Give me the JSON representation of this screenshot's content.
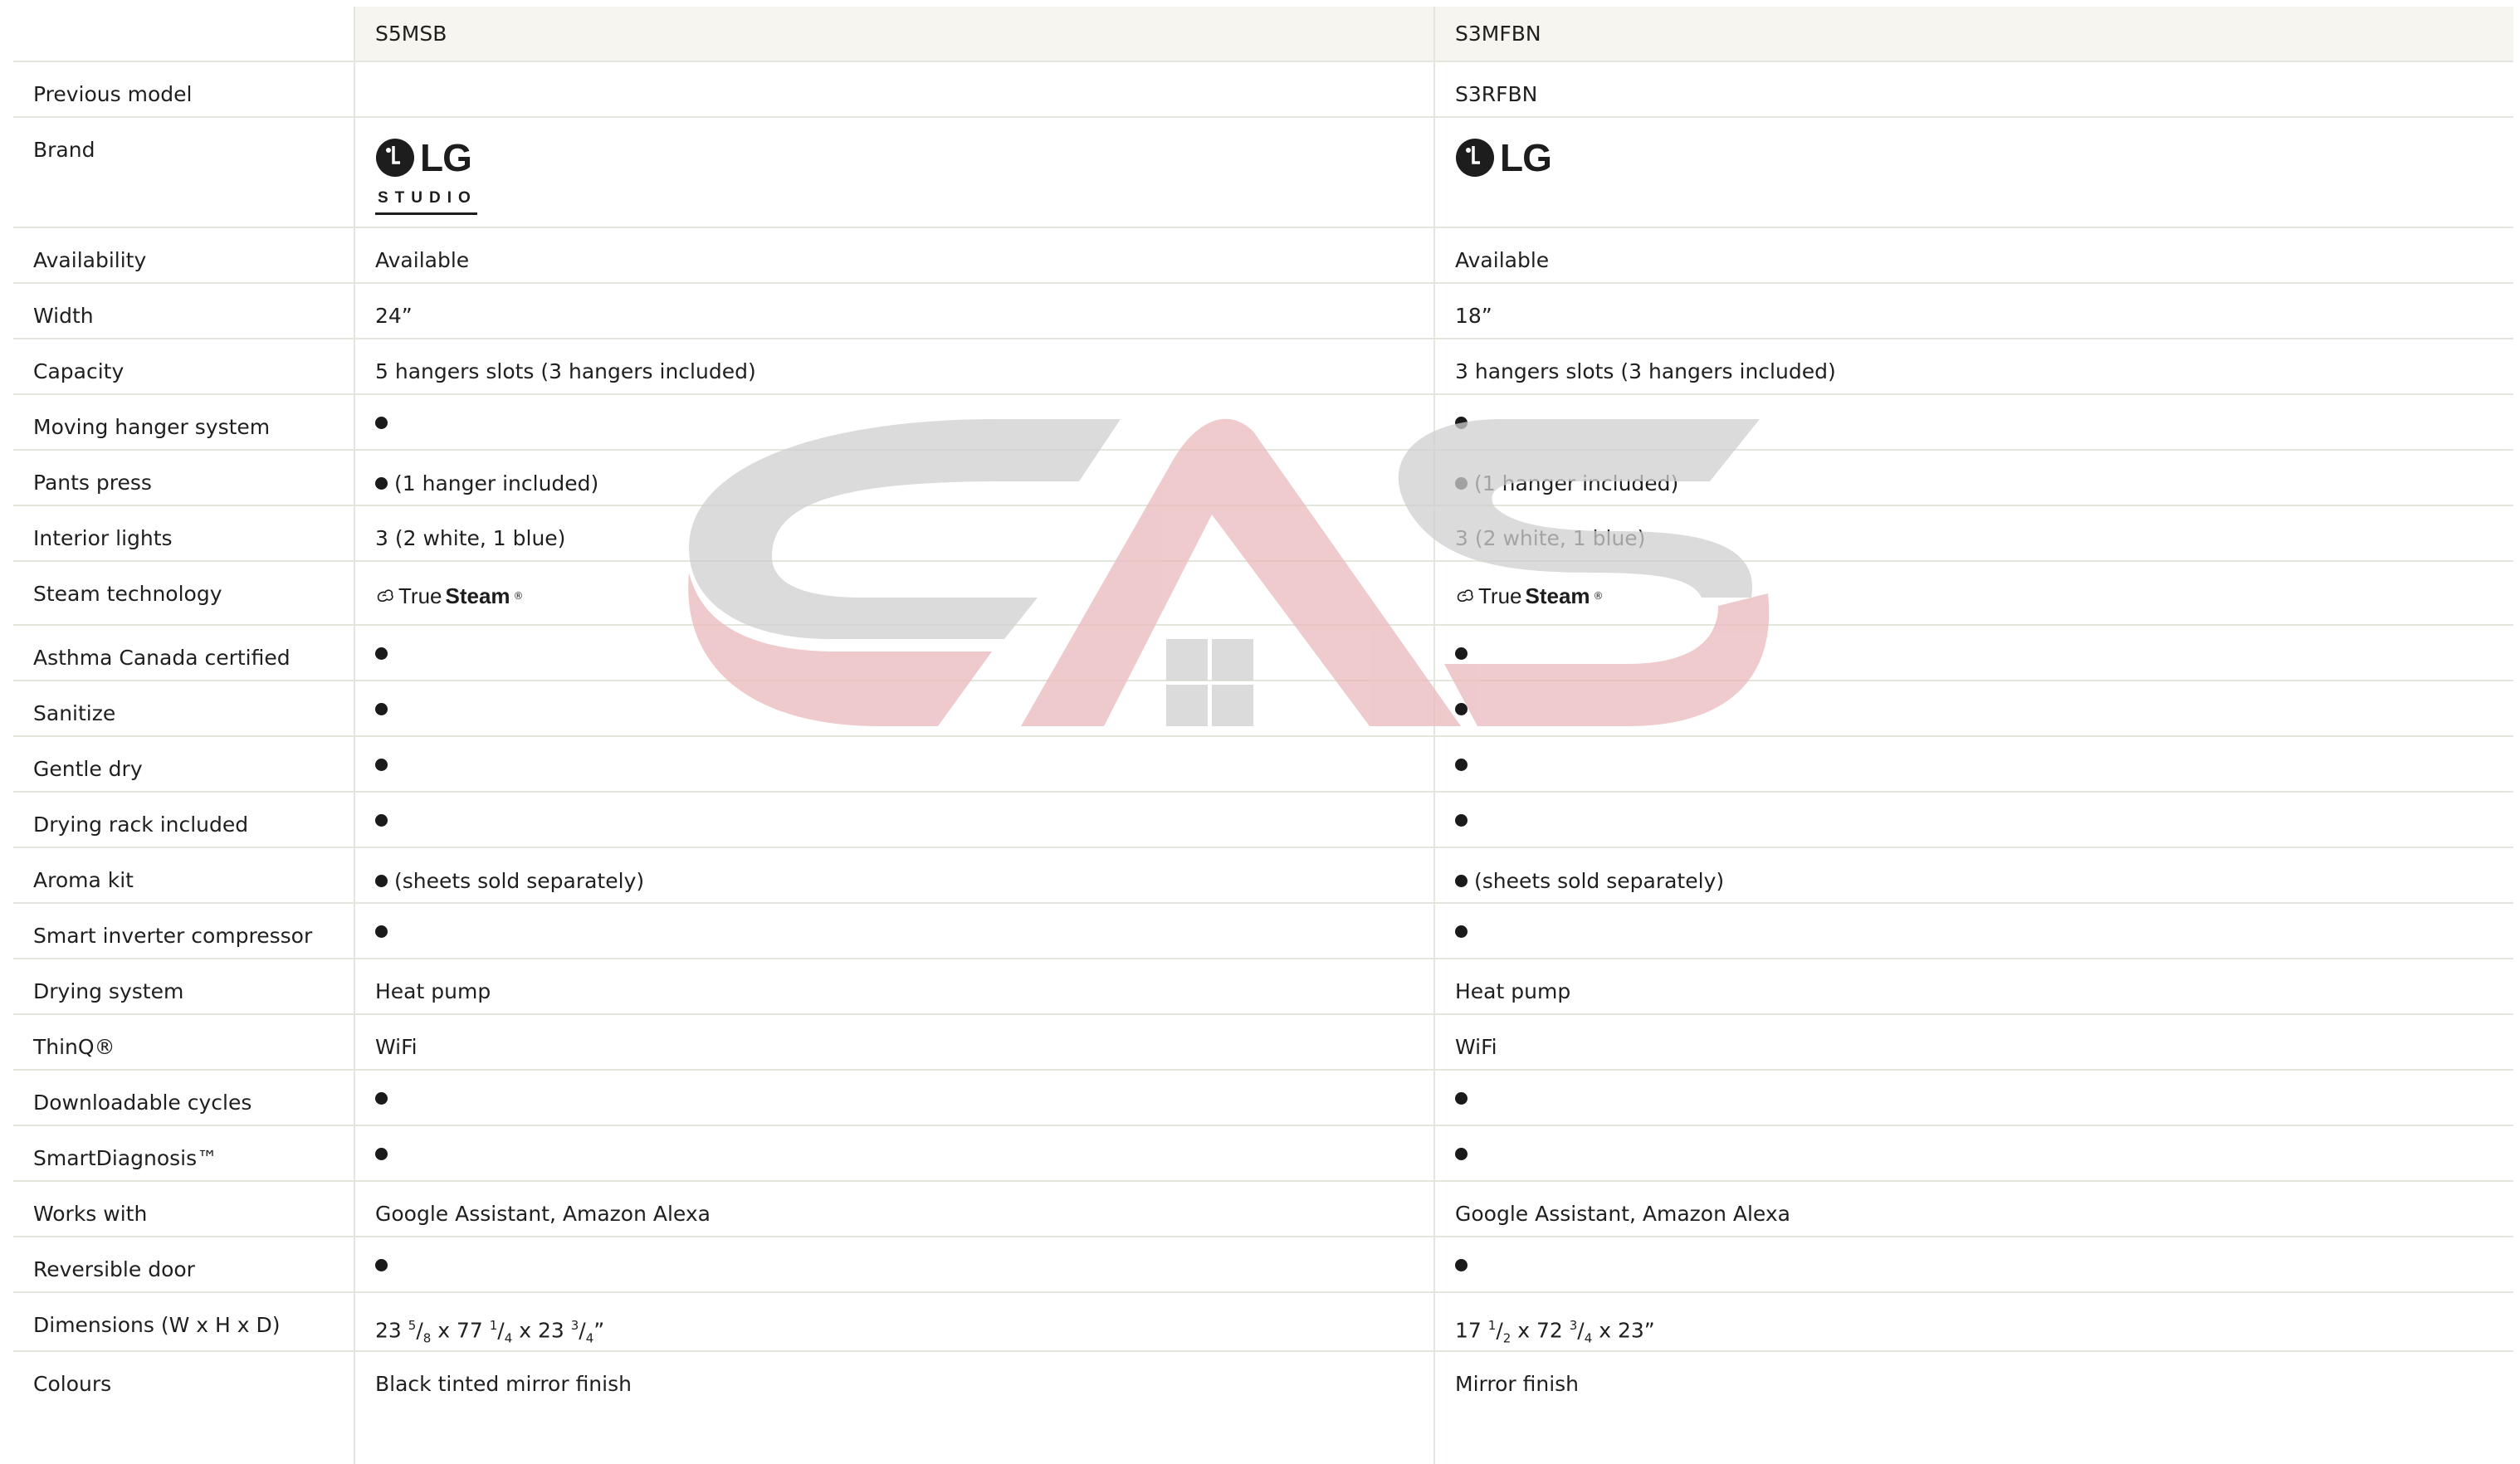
{
  "watermark": {
    "text": "CAS",
    "colors": {
      "gray": "#cfcfcf",
      "red": "#eab9bc"
    }
  },
  "columns": {
    "model_1": "S5MSB",
    "model_2": "S3MFBN"
  },
  "brand": {
    "col1": {
      "logo": "LG",
      "sub": "STUDIO",
      "icon": "lg-logo-icon"
    },
    "col2": {
      "logo": "LG",
      "icon": "lg-logo-icon"
    }
  },
  "steam": {
    "word1": "True",
    "word2": "Steam",
    "mark": "®",
    "icon": "steam-icon"
  },
  "dimensions": {
    "col1": {
      "a": "23 ",
      "a_num": "5",
      "a_den": "8",
      "b": " x 77 ",
      "b_num": "1",
      "b_den": "4",
      "c": " x 23 ",
      "c_num": "3",
      "c_den": "4",
      "end": "”"
    },
    "col2": {
      "a": "17 ",
      "a_num": "1",
      "a_den": "2",
      "b": " x 72 ",
      "b_num": "3",
      "b_den": "4",
      "c": " x 23”"
    }
  },
  "rows": {
    "previous_model": {
      "label": "Previous model",
      "v1": "",
      "v2": "S3RFBN"
    },
    "brand": {
      "label": "Brand"
    },
    "availability": {
      "label": "Availability",
      "v1": "Available",
      "v2": "Available"
    },
    "width": {
      "label": "Width",
      "v1": "24”",
      "v2": "18”"
    },
    "capacity": {
      "label": "Capacity",
      "v1": "5 hangers slots (3 hangers included)",
      "v2": "3 hangers slots (3 hangers included)"
    },
    "moving_hanger": {
      "label": "Moving hanger system",
      "v1": "●",
      "v2": "●"
    },
    "pants_press": {
      "label": "Pants press",
      "v1": "(1 hanger included)",
      "v2": "(1 hanger included)"
    },
    "interior_lights": {
      "label": "Interior lights",
      "v1": "3 (2 white, 1 blue)",
      "v2": "3 (2 white, 1 blue)"
    },
    "steam_technology": {
      "label": "Steam technology"
    },
    "asthma": {
      "label": "Asthma Canada certified",
      "v1": "●",
      "v2": "●"
    },
    "sanitize": {
      "label": "Sanitize",
      "v1": "●",
      "v2": "●"
    },
    "gentle_dry": {
      "label": "Gentle dry",
      "v1": "●",
      "v2": "●"
    },
    "drying_rack": {
      "label": "Drying rack included",
      "v1": "●",
      "v2": "●"
    },
    "aroma_kit": {
      "label": "Aroma kit",
      "v1": "(sheets sold separately)",
      "v2": "(sheets sold separately)"
    },
    "smart_inverter": {
      "label": "Smart inverter compressor",
      "v1": "●",
      "v2": "●"
    },
    "drying_system": {
      "label": "Drying system",
      "v1": "Heat pump",
      "v2": "Heat pump"
    },
    "thinq": {
      "label": "ThinQ®",
      "v1": "WiFi",
      "v2": "WiFi"
    },
    "downloadable": {
      "label": "Downloadable cycles",
      "v1": "●",
      "v2": "●"
    },
    "smartdiagnosis": {
      "label": "SmartDiagnosis™",
      "v1": "●",
      "v2": "●"
    },
    "works_with": {
      "label": "Works with",
      "v1": "Google Assistant, Amazon Alexa",
      "v2": "Google Assistant, Amazon Alexa"
    },
    "reversible_door": {
      "label": "Reversible door",
      "v1": "●",
      "v2": "●"
    },
    "dimensions": {
      "label": "Dimensions (W x H x D)"
    },
    "colours": {
      "label": "Colours",
      "v1": "Black tinted mirror finish",
      "v2": "Mirror finish"
    }
  }
}
